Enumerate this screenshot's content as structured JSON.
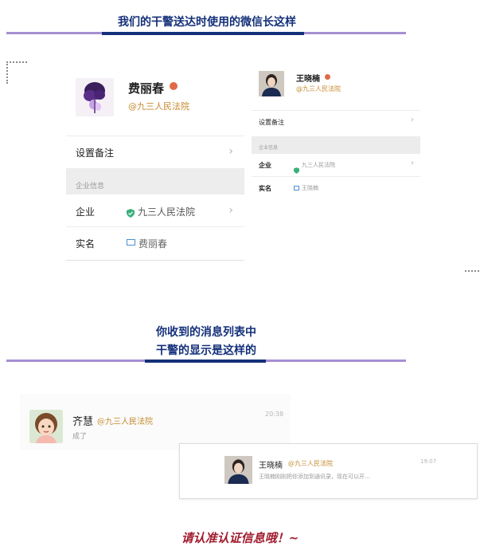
{
  "banners": {
    "top": "我们的干警送达时使用的微信长这样",
    "middle_line1": "你收到的消息列表中",
    "middle_line2": "干警的显示是这样的"
  },
  "card1": {
    "name": "费丽春",
    "org_tag": "@九三人民法院",
    "set_remark": "设置备注",
    "section_title": "企业信息",
    "company_label": "企业",
    "company_value": "九三人民法院",
    "realname_label": "实名",
    "realname_value": "费丽春"
  },
  "card2": {
    "name": "王晓楠",
    "org_tag": "@九三人民法院",
    "set_remark": "设置备注",
    "section_title": "企业信息",
    "company_label": "企业",
    "company_value": "九三人民法院",
    "realname_label": "实名",
    "realname_value": "王晓楠"
  },
  "messages": [
    {
      "name": "齐慧",
      "org_tag": "@九三人民法院",
      "preview": "成了",
      "time": "20:38"
    },
    {
      "name": "王晓楠",
      "org_tag": "@九三人民法院",
      "preview": "王晓楠刚刚把你添加到通讯录，现在可以开...",
      "time": "19:07"
    }
  ],
  "footer": {
    "notice": "请认准认证信息哦！~"
  },
  "icons": {
    "verified": "shield-check-icon",
    "realname": "id-card-icon",
    "person_badge": "person-badge-icon",
    "chevron": "chevron-right-icon"
  },
  "colors": {
    "banner_text": "#14307a",
    "banner_line": "#a58fd2",
    "org_tag": "#c58a2e",
    "footer_text": "#a11d2f",
    "verified_green": "#3bb07a"
  }
}
